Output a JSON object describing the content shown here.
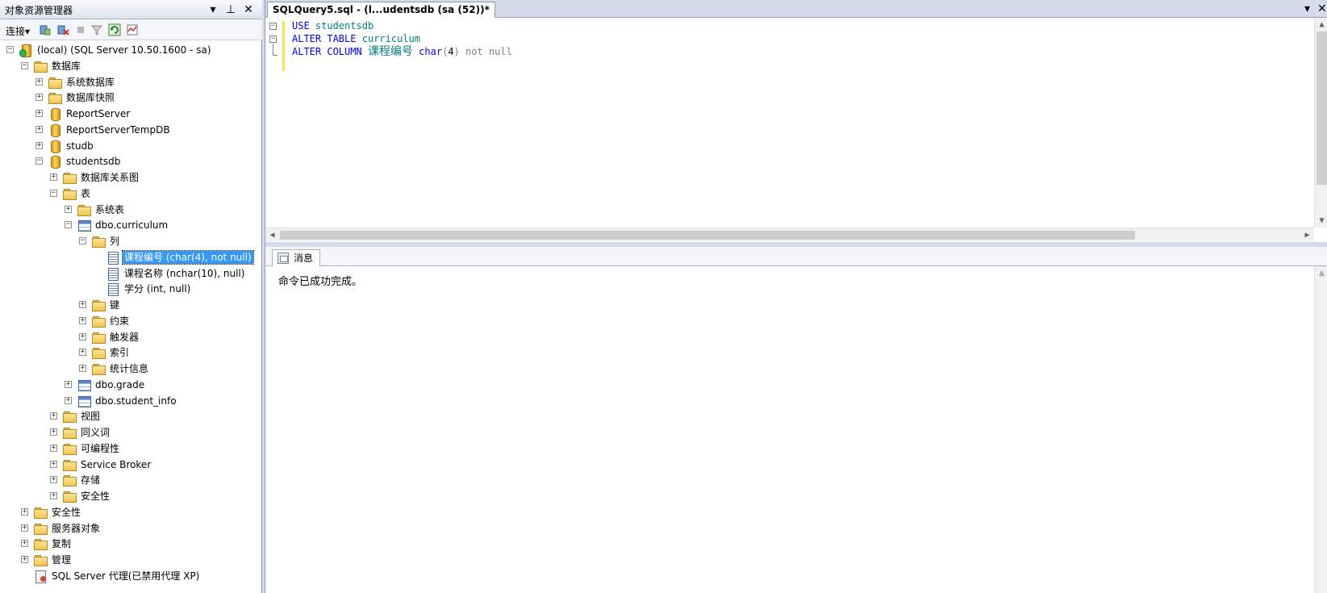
{
  "object_explorer": {
    "title": "对象资源管理器",
    "toolbar_connect": "连接",
    "pin_glyph": "⊥",
    "dropdown_glyph": "▾",
    "close_glyph": "✕",
    "tree": [
      {
        "label": "(local) (SQL Server 10.50.1600 - sa)",
        "level": 0,
        "icon": "server-icon",
        "expand": "−",
        "y": 0
      },
      {
        "label": "数据库",
        "level": 1,
        "icon": "folder-icon",
        "expand": "−",
        "y": 1
      },
      {
        "label": "系统数据库",
        "level": 2,
        "icon": "folder-icon",
        "expand": "+",
        "y": 2
      },
      {
        "label": "数据库快照",
        "level": 2,
        "icon": "folder-icon",
        "expand": "+",
        "y": 3
      },
      {
        "label": "ReportServer",
        "level": 2,
        "icon": "database-icon",
        "expand": "+",
        "y": 4
      },
      {
        "label": "ReportServerTempDB",
        "level": 2,
        "icon": "database-icon",
        "expand": "+",
        "y": 5
      },
      {
        "label": "studb",
        "level": 2,
        "icon": "database-icon",
        "expand": "+",
        "y": 6
      },
      {
        "label": "studentsdb",
        "level": 2,
        "icon": "database-icon",
        "expand": "−",
        "y": 7
      },
      {
        "label": "数据库关系图",
        "level": 3,
        "icon": "folder-icon",
        "expand": "+",
        "y": 8
      },
      {
        "label": "表",
        "level": 3,
        "icon": "folder-icon",
        "expand": "−",
        "y": 9
      },
      {
        "label": "系统表",
        "level": 4,
        "icon": "folder-icon",
        "expand": "+",
        "y": 10
      },
      {
        "label": "dbo.curriculum",
        "level": 4,
        "icon": "table-icon",
        "expand": "−",
        "y": 11
      },
      {
        "label": "列",
        "level": 5,
        "icon": "folder-icon",
        "expand": "−",
        "y": 12
      },
      {
        "label": "课程编号 (char(4), not null)",
        "level": 6,
        "icon": "column-icon",
        "expand": "",
        "y": 13,
        "selected": true
      },
      {
        "label": "课程名称 (nchar(10), null)",
        "level": 6,
        "icon": "column-icon",
        "expand": "",
        "y": 14
      },
      {
        "label": "学分 (int, null)",
        "level": 6,
        "icon": "column-icon",
        "expand": "",
        "y": 15
      },
      {
        "label": "键",
        "level": 5,
        "icon": "folder-icon",
        "expand": "+",
        "y": 16
      },
      {
        "label": "约束",
        "level": 5,
        "icon": "folder-icon",
        "expand": "+",
        "y": 17
      },
      {
        "label": "触发器",
        "level": 5,
        "icon": "folder-icon",
        "expand": "+",
        "y": 18
      },
      {
        "label": "索引",
        "level": 5,
        "icon": "folder-icon",
        "expand": "+",
        "y": 19
      },
      {
        "label": "统计信息",
        "level": 5,
        "icon": "folder-icon",
        "expand": "+",
        "y": 20
      },
      {
        "label": "dbo.grade",
        "level": 4,
        "icon": "table-icon",
        "expand": "+",
        "y": 21
      },
      {
        "label": "dbo.student_info",
        "level": 4,
        "icon": "table-icon",
        "expand": "+",
        "y": 22
      },
      {
        "label": "视图",
        "level": 3,
        "icon": "folder-icon",
        "expand": "+",
        "y": 23
      },
      {
        "label": "同义词",
        "level": 3,
        "icon": "folder-icon",
        "expand": "+",
        "y": 24
      },
      {
        "label": "可编程性",
        "level": 3,
        "icon": "folder-icon",
        "expand": "+",
        "y": 25
      },
      {
        "label": "Service Broker",
        "level": 3,
        "icon": "folder-icon",
        "expand": "+",
        "y": 26
      },
      {
        "label": "存储",
        "level": 3,
        "icon": "folder-icon",
        "expand": "+",
        "y": 27
      },
      {
        "label": "安全性",
        "level": 3,
        "icon": "folder-icon",
        "expand": "+",
        "y": 28
      },
      {
        "label": "安全性",
        "level": 1,
        "icon": "folder-icon",
        "expand": "+",
        "y": 29
      },
      {
        "label": "服务器对象",
        "level": 1,
        "icon": "folder-icon",
        "expand": "+",
        "y": 30
      },
      {
        "label": "复制",
        "level": 1,
        "icon": "folder-icon",
        "expand": "+",
        "y": 31
      },
      {
        "label": "管理",
        "level": 1,
        "icon": "folder-icon",
        "expand": "+",
        "y": 32
      },
      {
        "label": "SQL Server 代理(已禁用代理 XP)",
        "level": 1,
        "icon": "agent-icon",
        "expand": "",
        "y": 33
      }
    ]
  },
  "editor": {
    "tab_title": "SQLQuery5.sql - (l...udentsdb (sa (52))*",
    "tab_dropdown_glyph": "▾",
    "tab_close_glyph": "✕",
    "line1_kw": "USE",
    "line1_id": "studentsdb",
    "line2_kw": "ALTER TABLE",
    "line2_id": "curriculum",
    "line3_kw": "ALTER COLUMN",
    "line3_col": "课程编号",
    "line3_type": "char",
    "line3_paren_open": "(",
    "line3_num": "4",
    "line3_paren_close": ")",
    "line3_tail": "not null"
  },
  "results": {
    "tab_label": "消息",
    "message": "命令已成功完成。"
  },
  "scroll_glyphs": {
    "up": "▲",
    "down": "▼",
    "left": "◀",
    "right": "▶"
  }
}
